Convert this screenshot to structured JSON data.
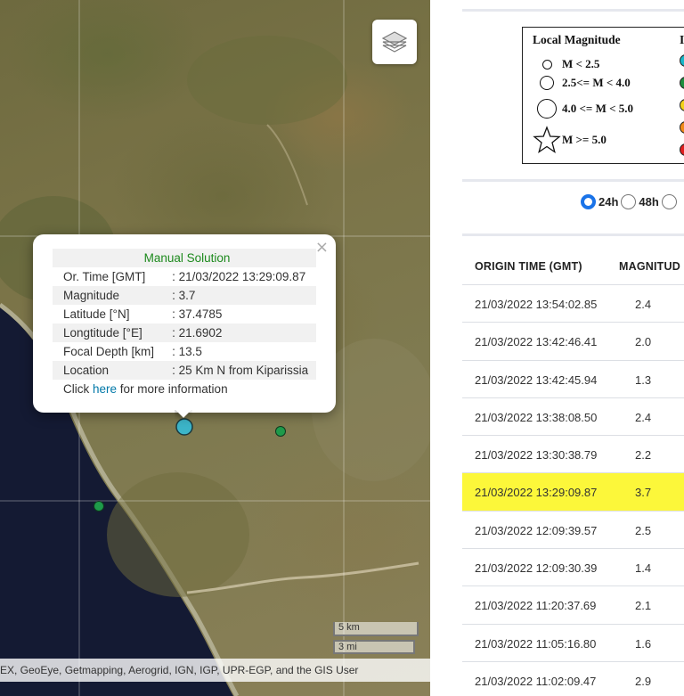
{
  "map": {
    "layers_icon": "layers-icon",
    "popup": {
      "title": "Manual Solution",
      "close": "×",
      "rows": [
        {
          "label": "Or. Time [GMT]",
          "value": ": 21/03/2022 13:29:09.87"
        },
        {
          "label": "Magnitude",
          "value": ": 3.7"
        },
        {
          "label": "Latitude [°N]",
          "value": ": 37.4785"
        },
        {
          "label": "Longtitude [°E]",
          "value": ": 21.6902"
        },
        {
          "label": "Focal Depth [km]",
          "value": ": 13.5"
        },
        {
          "label": "Location",
          "value": ": 25 Km N from Kiparissia"
        }
      ],
      "more_prefix": "Click ",
      "more_link": "here",
      "more_suffix": " for more information"
    },
    "markers": {
      "selected_color": "#3cb5c9",
      "small_color": "#1e9a4a"
    },
    "scale": {
      "km": "5 km",
      "mi": "3 mi"
    },
    "attribution": "EX, GeoEye, Getmapping, Aerogrid, IGN, IGP, UPR-EGP, and the GIS User"
  },
  "legend": {
    "title": "Local Magnitude",
    "title2": "I",
    "items": [
      "M < 2.5",
      "2.5<= M < 4.0",
      "4.0 <= M < 5.0",
      "M >= 5.0"
    ],
    "colors": [
      "#1ab7c9",
      "#1e8f3e",
      "#f2d21a",
      "#f08a1a",
      "#e02020"
    ]
  },
  "filter": {
    "options": [
      {
        "label": "24h",
        "checked": true
      },
      {
        "label": "48h",
        "checked": false
      },
      {
        "label": "",
        "checked": false
      }
    ],
    "accent": "#1a73e8"
  },
  "table": {
    "headers": [
      "ORIGIN TIME (GMT)",
      "MAGNITUD"
    ],
    "rows": [
      {
        "time": "21/03/2022 13:54:02.85",
        "mag": "2.4"
      },
      {
        "time": "21/03/2022 13:42:46.41",
        "mag": "2.0"
      },
      {
        "time": "21/03/2022 13:42:45.94",
        "mag": "1.3"
      },
      {
        "time": "21/03/2022 13:38:08.50",
        "mag": "2.4"
      },
      {
        "time": "21/03/2022 13:30:38.79",
        "mag": "2.2"
      },
      {
        "time": "21/03/2022 13:29:09.87",
        "mag": "3.7"
      },
      {
        "time": "21/03/2022 12:09:39.57",
        "mag": "2.5"
      },
      {
        "time": "21/03/2022 12:09:30.39",
        "mag": "1.4"
      },
      {
        "time": "21/03/2022 11:20:37.69",
        "mag": "2.1"
      },
      {
        "time": "21/03/2022 11:05:16.80",
        "mag": "1.6"
      },
      {
        "time": "21/03/2022 11:02:09.47",
        "mag": "2.9"
      }
    ],
    "highlight_row": 5,
    "highlight_color": "#fcf73a"
  }
}
